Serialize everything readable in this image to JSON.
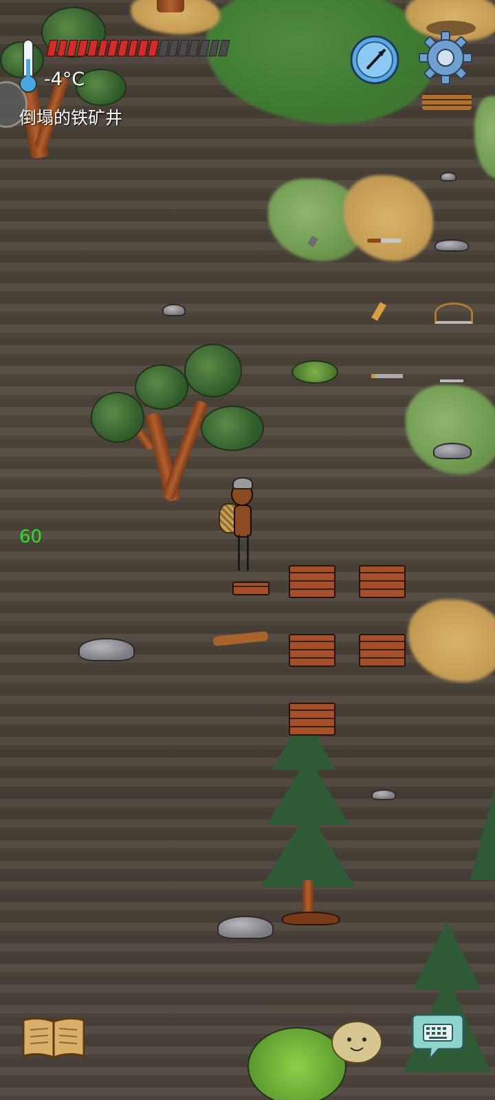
{
  "hud": {
    "temperature": "-4°C",
    "location": "倒塌的铁矿井",
    "fps": "60",
    "health": {
      "filled_segments": 11,
      "total_segments": 18
    },
    "icons": {
      "thermometer": "thermometer-icon",
      "compass": "compass-icon",
      "settings": "gear-icon",
      "journal": "journal-book-icon",
      "chat": "keyboard-chat-icon",
      "companion": "potato-face-icon",
      "side_tab": "side-tab-icon"
    }
  },
  "colors": {
    "health_fill": "#d32a2a",
    "health_empty": "#4a4a4a",
    "fps_text": "#2ee02e",
    "ground": "#4e463d"
  }
}
